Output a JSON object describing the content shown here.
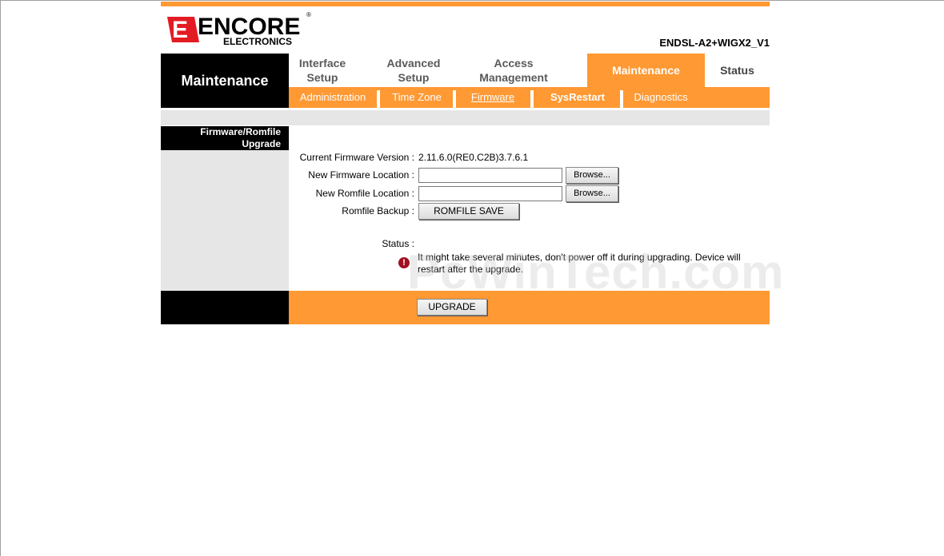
{
  "brand": {
    "logo_text": "ENCORE",
    "logo_sub": "ELECTRONICS",
    "model": "ENDSL-A2+WIGX2_V1"
  },
  "page_title": "Maintenance",
  "tabs": [
    {
      "label": "Interface Setup"
    },
    {
      "label": "Advanced Setup"
    },
    {
      "label": "Access Management"
    },
    {
      "label": "Maintenance",
      "active": true
    },
    {
      "label": "Status"
    }
  ],
  "subtabs": [
    {
      "label": "Administration"
    },
    {
      "label": "Time Zone"
    },
    {
      "label": "Firmware",
      "current": true
    },
    {
      "label": "SysRestart"
    },
    {
      "label": "Diagnostics"
    }
  ],
  "section": {
    "title_line1": "Firmware/Romfile",
    "title_line2": "Upgrade"
  },
  "form": {
    "current_version_label": "Current Firmware Version :",
    "current_version_value": "2.11.6.0(RE0.C2B)3.7.6.1",
    "new_firmware_label": "New Firmware Location :",
    "new_firmware_value": "",
    "new_romfile_label": "New Romfile Location :",
    "new_romfile_value": "",
    "browse_label": "Browse...",
    "romfile_backup_label": "Romfile Backup :",
    "romfile_save_label": "ROMFILE SAVE",
    "status_label": "Status :",
    "warning_line1": "It might take several minutes, don't power off it during upgrading. Device will",
    "warning_line2": "restart after the upgrade."
  },
  "footer": {
    "upgrade_label": "UPGRADE"
  },
  "watermark": "PcWinTech.com",
  "colors": {
    "accent": "#ff9933",
    "black": "#000000",
    "grey": "#e6e6e6"
  }
}
